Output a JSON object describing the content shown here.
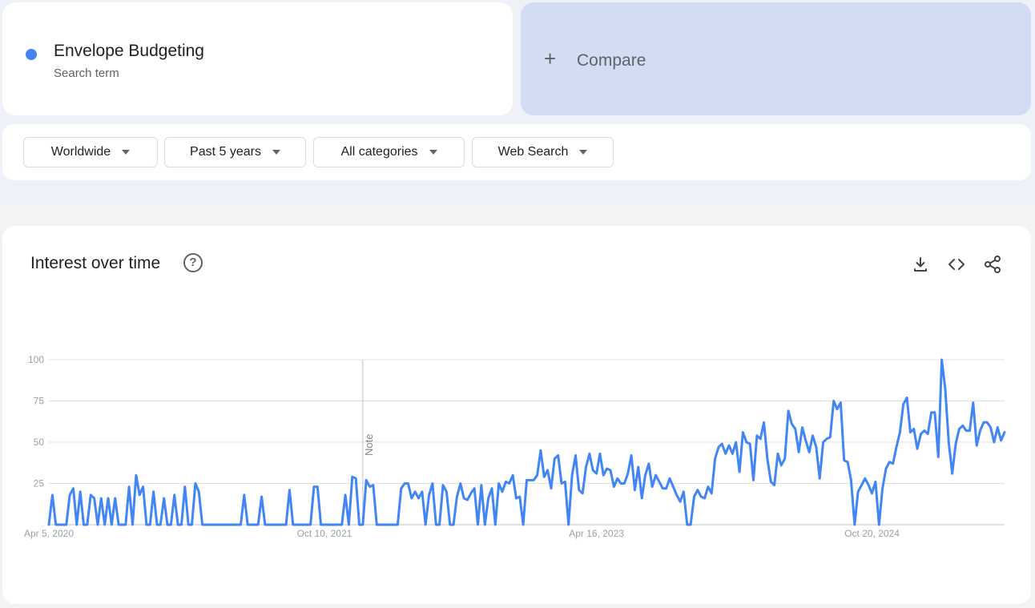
{
  "term": {
    "name": "Envelope Budgeting",
    "subtitle": "Search term",
    "color": "#4285f4"
  },
  "compare": {
    "plus": "+",
    "label": "Compare"
  },
  "filters": [
    {
      "label": "Worldwide"
    },
    {
      "label": "Past 5 years"
    },
    {
      "label": "All categories"
    },
    {
      "label": "Web Search"
    }
  ],
  "chart_card": {
    "title": "Interest over time",
    "help": "?",
    "tools": [
      "download-icon",
      "embed-icon",
      "share-icon"
    ]
  },
  "chart_data": {
    "type": "line",
    "title": "Interest over time",
    "xlabel": "",
    "ylabel": "",
    "ylim": [
      0,
      100
    ],
    "yticks": [
      25,
      50,
      75,
      100
    ],
    "xtick_labels": [
      "Apr 5, 2020",
      "Oct 10, 2021",
      "Apr 16, 2023",
      "Oct 20, 2024"
    ],
    "xtick_indices": [
      0,
      79,
      157,
      236
    ],
    "note_index": 90,
    "note_label": "Note",
    "grid": true,
    "series": [
      {
        "color": "#4285f4",
        "values": [
          0,
          18,
          0,
          0,
          0,
          0,
          18,
          22,
          0,
          20,
          0,
          0,
          18,
          16,
          0,
          16,
          0,
          16,
          0,
          16,
          0,
          0,
          0,
          23,
          0,
          30,
          18,
          23,
          0,
          0,
          20,
          0,
          0,
          16,
          0,
          0,
          18,
          0,
          0,
          23,
          0,
          0,
          25,
          20,
          0,
          0,
          0,
          0,
          0,
          0,
          0,
          0,
          0,
          0,
          0,
          0,
          18,
          0,
          0,
          0,
          0,
          17,
          0,
          0,
          0,
          0,
          0,
          0,
          0,
          21,
          0,
          0,
          0,
          0,
          0,
          0,
          23,
          23,
          0,
          0,
          0,
          0,
          0,
          0,
          0,
          18,
          0,
          29,
          28,
          0,
          0,
          27,
          23,
          24,
          0,
          0,
          0,
          0,
          0,
          0,
          0,
          22,
          25,
          25,
          16,
          20,
          16,
          20,
          0,
          18,
          25,
          0,
          0,
          24,
          20,
          0,
          0,
          17,
          25,
          16,
          15,
          19,
          22,
          0,
          24,
          0,
          16,
          22,
          0,
          25,
          20,
          26,
          25,
          30,
          16,
          17,
          0,
          27,
          27,
          27,
          30,
          45,
          29,
          33,
          22,
          40,
          42,
          25,
          26,
          0,
          30,
          42,
          21,
          19,
          35,
          43,
          33,
          31,
          43,
          30,
          34,
          33,
          23,
          28,
          25,
          25,
          31,
          42,
          21,
          35,
          16,
          30,
          37,
          23,
          30,
          26,
          22,
          22,
          28,
          23,
          18,
          14,
          20,
          0,
          0,
          17,
          21,
          17,
          16,
          23,
          19,
          40,
          47,
          49,
          43,
          48,
          43,
          50,
          32,
          56,
          50,
          49,
          27,
          54,
          52,
          62,
          40,
          26,
          24,
          43,
          36,
          40,
          69,
          61,
          58,
          44,
          59,
          51,
          44,
          54,
          47,
          28,
          50,
          52,
          53,
          75,
          70,
          74,
          39,
          38,
          27,
          0,
          20,
          24,
          28,
          24,
          19,
          26,
          0,
          22,
          34,
          38,
          37,
          47,
          56,
          73,
          77,
          56,
          58,
          46,
          55,
          57,
          55,
          68,
          68,
          41,
          100,
          82,
          50,
          31,
          49,
          58,
          60,
          57,
          57,
          74,
          48,
          57,
          62,
          62,
          59,
          50,
          59,
          51,
          56
        ]
      }
    ]
  }
}
